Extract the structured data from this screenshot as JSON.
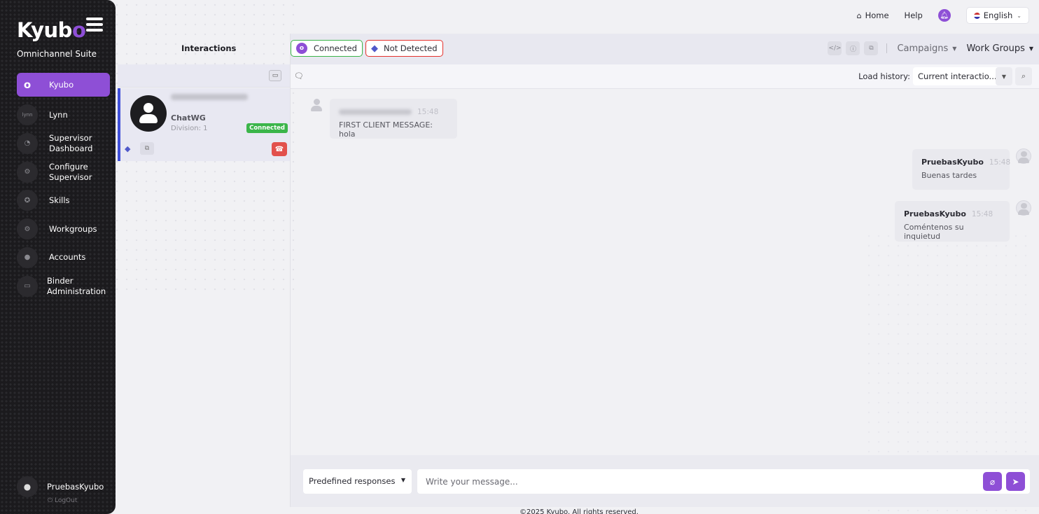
{
  "sidebar": {
    "logo_main": "Kyub",
    "logo_accent": "o",
    "suite": "Omnichannel Suite",
    "items": [
      {
        "label": "Kyubo",
        "icon": "kyubo-icon",
        "glyph": "o"
      },
      {
        "label": "Lynn",
        "icon": "lynn-icon",
        "glyph": "lynn"
      },
      {
        "label": "Supervisor Dashboard",
        "icon": "dashboard-icon",
        "glyph": "◔"
      },
      {
        "label": "Configure Supervisor",
        "icon": "user-gear-icon",
        "glyph": "⚙"
      },
      {
        "label": "Skills",
        "icon": "award-icon",
        "glyph": "✪"
      },
      {
        "label": "Workgroups",
        "icon": "users-gear-icon",
        "glyph": "⚙"
      },
      {
        "label": "Accounts",
        "icon": "users-icon",
        "glyph": "●"
      },
      {
        "label": "Binder Administration",
        "icon": "folder-icon",
        "glyph": "▭"
      }
    ],
    "user_name": "PruebasKyubo",
    "logout": "LogOut"
  },
  "topbar": {
    "home": "Home",
    "help": "Help",
    "language": "English"
  },
  "interactions": {
    "title": "Interactions",
    "card": {
      "channel": "ChatWG",
      "division": "Division: 1",
      "status": "Connected"
    }
  },
  "chat_header": {
    "connected": "Connected",
    "not_detected": "Not Detected",
    "campaigns": "Campaigns",
    "work_groups": "Work Groups",
    "load_history_label": "Load history:",
    "load_history_value": "Current interactio..."
  },
  "messages": [
    {
      "direction": "in",
      "sender": "",
      "time": "15:48",
      "text": "FIRST CLIENT MESSAGE: hola"
    },
    {
      "direction": "out",
      "sender": "PruebasKyubo",
      "time": "15:48",
      "text": "Buenas tardes"
    },
    {
      "direction": "out",
      "sender": "PruebasKyubo",
      "time": "15:48",
      "text": "Coméntenos su inquietud"
    }
  ],
  "composer": {
    "predefined": "Predefined responses",
    "placeholder": "Write your message..."
  },
  "footer": "©2025 Kyubo. All rights reserved.",
  "colors": {
    "accent": "#8e4fd6",
    "connected": "#3bb54a",
    "alert": "#e5322d",
    "sidebar": "#1b1a1d"
  }
}
